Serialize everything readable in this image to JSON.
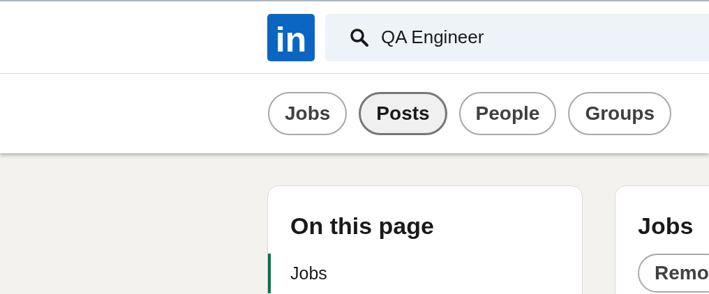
{
  "header": {
    "logo": {
      "text": "in"
    },
    "search": {
      "value": "QA Engineer"
    }
  },
  "filters": [
    {
      "label": "Jobs",
      "selected": false
    },
    {
      "label": "Posts",
      "selected": true
    },
    {
      "label": "People",
      "selected": false
    },
    {
      "label": "Groups",
      "selected": false
    }
  ],
  "on_this_page": {
    "title": "On this page",
    "items": [
      {
        "label": "Jobs",
        "selected": true
      }
    ]
  },
  "jobs_card": {
    "title": "Jobs",
    "chips": [
      "Remo"
    ]
  }
}
